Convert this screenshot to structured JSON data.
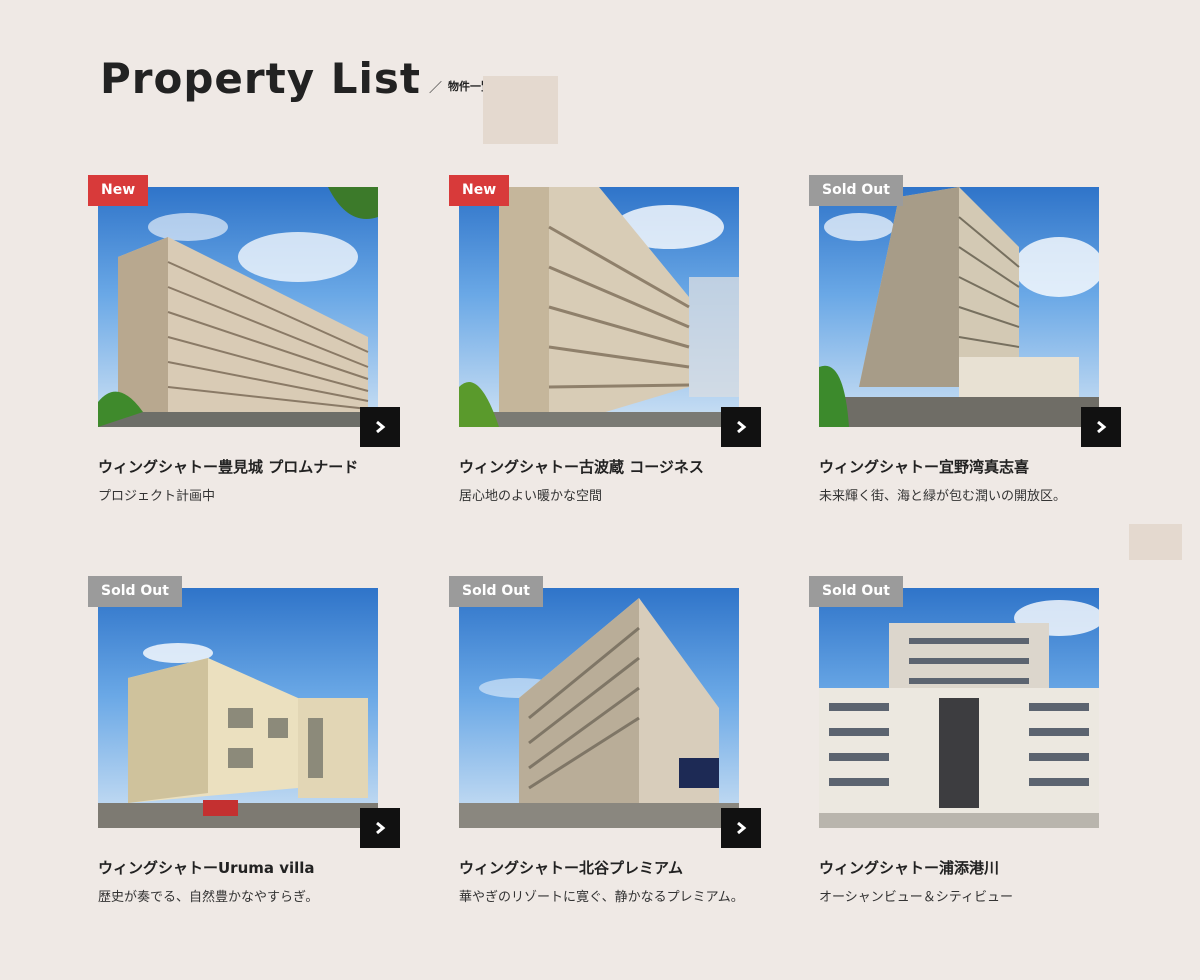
{
  "header": {
    "title": "Property List",
    "slash": "／",
    "subtitle": "物件一覧"
  },
  "properties": [
    {
      "badge": "New",
      "badge_type": "new",
      "name": "ウィングシャトー豊見城 プロムナード",
      "description": "プロジェクト計画中"
    },
    {
      "badge": "New",
      "badge_type": "new",
      "name": "ウィングシャトー古波蔵 コージネス",
      "description": "居心地のよい暖かな空間"
    },
    {
      "badge": "Sold Out",
      "badge_type": "sold",
      "name": "ウィングシャトー宜野湾真志喜",
      "description": "未来輝く街、海と緑が包む潤いの開放区。"
    },
    {
      "badge": "Sold Out",
      "badge_type": "sold",
      "name": "ウィングシャトーUruma villa",
      "description": "歴史が奏でる、自然豊かなやすらぎ。"
    },
    {
      "badge": "Sold Out",
      "badge_type": "sold",
      "name": "ウィングシャトー北谷プレミアム",
      "description": "華やぎのリゾートに寛ぐ、静かなるプレミアム。"
    },
    {
      "badge": "Sold Out",
      "badge_type": "sold",
      "name": "ウィングシャトー浦添港川",
      "description": "オーシャンビュー＆シティビュー"
    }
  ],
  "colors": {
    "background": "#efe9e5",
    "new_badge": "#d83a3a",
    "soldout_badge": "#9b9b9b",
    "arrow_button": "#111111"
  },
  "icons": {
    "arrow": "chevron-right-icon"
  }
}
